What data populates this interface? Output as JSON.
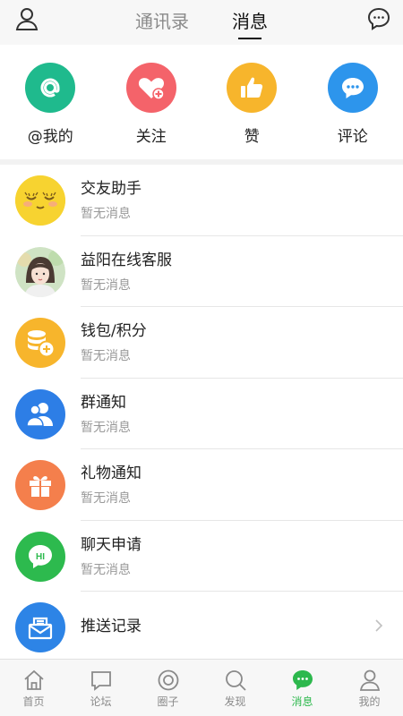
{
  "header": {
    "left_icon": "person-icon",
    "right_icon": "chat-bubble-icon",
    "tabs": [
      {
        "label": "通讯录",
        "active": false
      },
      {
        "label": "消息",
        "active": true
      }
    ]
  },
  "quick_actions": [
    {
      "label": "@我的",
      "icon": "at-icon",
      "color": "#1fba8d"
    },
    {
      "label": "关注",
      "icon": "heart-plus-icon",
      "color": "#f4636a"
    },
    {
      "label": "赞",
      "icon": "thumbs-up-icon",
      "color": "#f7b52c"
    },
    {
      "label": "评论",
      "icon": "comment-icon",
      "color": "#2d95ec"
    }
  ],
  "list": [
    {
      "title": "交友助手",
      "subtitle": "暂无消息",
      "icon": "smiley-face-icon",
      "color": "#f7d330"
    },
    {
      "title": "益阳在线客服",
      "subtitle": "暂无消息",
      "icon": "user-photo-avatar",
      "color": "#d8c7b8"
    },
    {
      "title": "钱包/积分",
      "subtitle": "暂无消息",
      "icon": "coins-icon",
      "color": "#f7b52c"
    },
    {
      "title": "群通知",
      "subtitle": "暂无消息",
      "icon": "group-icon",
      "color": "#2d7ee6"
    },
    {
      "title": "礼物通知",
      "subtitle": "暂无消息",
      "icon": "gift-icon",
      "color": "#f47f4c"
    },
    {
      "title": "聊天申请",
      "subtitle": "暂无消息",
      "icon": "hi-bubble-icon",
      "color": "#2dba4e",
      "icon_text": "HI"
    },
    {
      "title": "推送记录",
      "subtitle": "",
      "icon": "inbox-icon",
      "color": "#2d84e6"
    }
  ],
  "bottom_nav": [
    {
      "label": "首页",
      "icon": "home-icon",
      "active": false
    },
    {
      "label": "论坛",
      "icon": "forum-icon",
      "active": false
    },
    {
      "label": "圈子",
      "icon": "circle-icon",
      "active": false
    },
    {
      "label": "发现",
      "icon": "search-icon",
      "active": false
    },
    {
      "label": "消息",
      "icon": "message-icon",
      "active": true
    },
    {
      "label": "我的",
      "icon": "profile-icon",
      "active": false
    }
  ]
}
